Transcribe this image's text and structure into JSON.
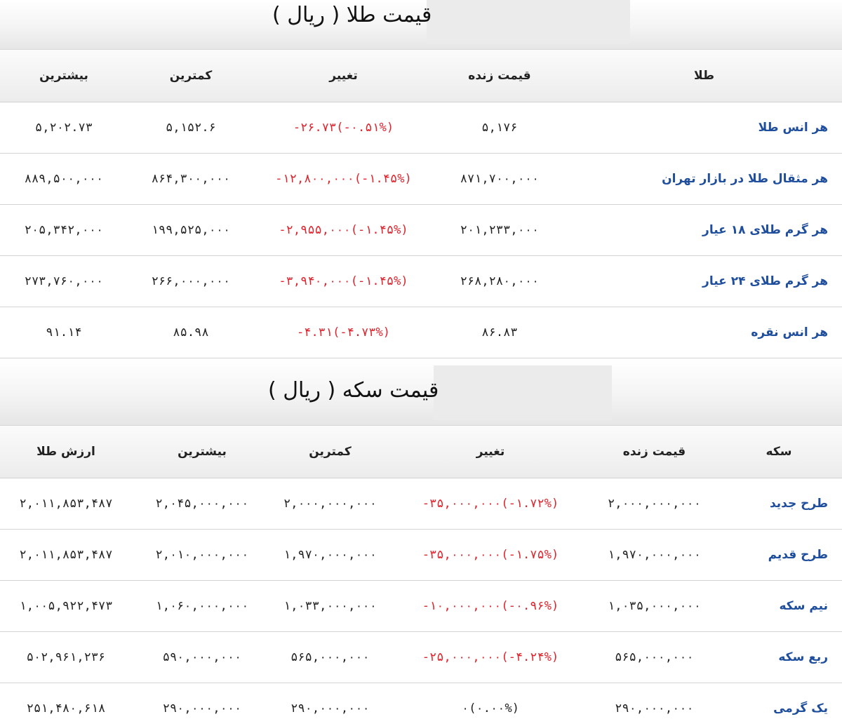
{
  "gold_section": {
    "title": "قیمت طلا ( ریال )",
    "headers": {
      "item": "طلا",
      "live_price": "قیمت زنده",
      "change": "تغییر",
      "min": "کمترین",
      "max": "بیشترین"
    },
    "rows": [
      {
        "name": "هر انس طلا",
        "live_price": "۵,۱۷۶",
        "change": "-۲۶.۷۳(-۰.۵۱%)",
        "min": "۵,۱۵۲.۶",
        "max": "۵,۲۰۲.۷۳"
      },
      {
        "name": "هر مثقال طلا در بازار تهران",
        "live_price": "۸۷۱,۷۰۰,۰۰۰",
        "change": "-۱۲,۸۰۰,۰۰۰(-۱.۴۵%)",
        "min": "۸۶۴,۳۰۰,۰۰۰",
        "max": "۸۸۹,۵۰۰,۰۰۰"
      },
      {
        "name": "هر گرم طلای ۱۸ عیار",
        "live_price": "۲۰۱,۲۳۳,۰۰۰",
        "change": "-۲,۹۵۵,۰۰۰(-۱.۴۵%)",
        "min": "۱۹۹,۵۲۵,۰۰۰",
        "max": "۲۰۵,۳۴۲,۰۰۰"
      },
      {
        "name": "هر گرم طلای ۲۴ عیار",
        "live_price": "۲۶۸,۲۸۰,۰۰۰",
        "change": "-۳,۹۴۰,۰۰۰(-۱.۴۵%)",
        "min": "۲۶۶,۰۰۰,۰۰۰",
        "max": "۲۷۳,۷۶۰,۰۰۰"
      },
      {
        "name": "هر انس نقره",
        "live_price": "۸۶.۸۳",
        "change": "-۴.۳۱(-۴.۷۳%)",
        "min": "۸۵.۹۸",
        "max": "۹۱.۱۴"
      }
    ]
  },
  "coin_section": {
    "title": "قیمت سکه ( ریال )",
    "headers": {
      "item": "سکه",
      "live_price": "قیمت زنده",
      "change": "تغییر",
      "min": "کمترین",
      "max": "بیشترین",
      "gold_value": "ارزش طلا"
    },
    "rows": [
      {
        "name": "طرح جدید",
        "live_price": "۲,۰۰۰,۰۰۰,۰۰۰",
        "change": "-۳۵,۰۰۰,۰۰۰(-۱.۷۲%)",
        "min": "۲,۰۰۰,۰۰۰,۰۰۰",
        "max": "۲,۰۴۵,۰۰۰,۰۰۰",
        "gold_value": "۲,۰۱۱,۸۵۳,۴۸۷"
      },
      {
        "name": "طرح قدیم",
        "live_price": "۱,۹۷۰,۰۰۰,۰۰۰",
        "change": "-۳۵,۰۰۰,۰۰۰(-۱.۷۵%)",
        "min": "۱,۹۷۰,۰۰۰,۰۰۰",
        "max": "۲,۰۱۰,۰۰۰,۰۰۰",
        "gold_value": "۲,۰۱۱,۸۵۳,۴۸۷"
      },
      {
        "name": "نیم سکه",
        "live_price": "۱,۰۳۵,۰۰۰,۰۰۰",
        "change": "-۱۰,۰۰۰,۰۰۰(-۰.۹۶%)",
        "min": "۱,۰۳۳,۰۰۰,۰۰۰",
        "max": "۱,۰۶۰,۰۰۰,۰۰۰",
        "gold_value": "۱,۰۰۵,۹۲۲,۴۷۳"
      },
      {
        "name": "ربع سکه",
        "live_price": "۵۶۵,۰۰۰,۰۰۰",
        "change": "-۲۵,۰۰۰,۰۰۰(-۴.۲۴%)",
        "min": "۵۶۵,۰۰۰,۰۰۰",
        "max": "۵۹۰,۰۰۰,۰۰۰",
        "gold_value": "۵۰۲,۹۶۱,۲۳۶"
      },
      {
        "name": "یک گرمی",
        "live_price": "۲۹۰,۰۰۰,۰۰۰",
        "change": "۰(۰.۰۰%)",
        "min": "۲۹۰,۰۰۰,۰۰۰",
        "max": "۲۹۰,۰۰۰,۰۰۰",
        "gold_value": "۲۵۱,۴۸۰,۶۱۸"
      }
    ]
  }
}
